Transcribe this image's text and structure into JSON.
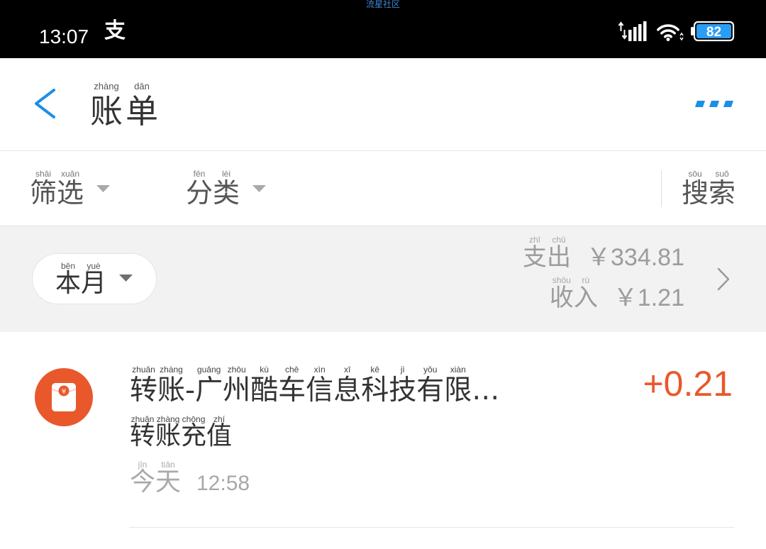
{
  "status_bar": {
    "watermark": "流星社区",
    "time": "13:07",
    "app_glyph": "支",
    "battery_level": "82"
  },
  "header": {
    "title": [
      {
        "char": "账",
        "py": "zhàng"
      },
      {
        "char": "单",
        "py": "dān"
      }
    ]
  },
  "filters": {
    "filter": [
      {
        "char": "筛",
        "py": "shāi"
      },
      {
        "char": "选",
        "py": "xuǎn"
      }
    ],
    "category": [
      {
        "char": "分",
        "py": "fēn"
      },
      {
        "char": "类",
        "py": "lèi"
      }
    ],
    "search": [
      {
        "char": "搜",
        "py": "sōu"
      },
      {
        "char": "索",
        "py": "suǒ"
      }
    ]
  },
  "summary": {
    "period": [
      {
        "char": "本",
        "py": "běn"
      },
      {
        "char": "月",
        "py": "yuè"
      }
    ],
    "expense_label": [
      {
        "char": "支",
        "py": "zhī"
      },
      {
        "char": "出",
        "py": "chū"
      }
    ],
    "expense_amount": "￥334.81",
    "income_label": [
      {
        "char": "收",
        "py": "shōu"
      },
      {
        "char": "入",
        "py": "rù"
      }
    ],
    "income_amount": "￥1.21"
  },
  "transactions": [
    {
      "icon_glyph": "¥",
      "title": [
        {
          "char": "转",
          "py": "zhuǎn"
        },
        {
          "char": "账",
          "py": "zhàng"
        },
        {
          "char": "-",
          "py": ""
        },
        {
          "char": "广",
          "py": "guǎng"
        },
        {
          "char": "州",
          "py": "zhōu"
        },
        {
          "char": "酷",
          "py": "kù"
        },
        {
          "char": "车",
          "py": "chē"
        },
        {
          "char": "信",
          "py": "xìn"
        },
        {
          "char": "息",
          "py": "xī"
        },
        {
          "char": "科",
          "py": "kē"
        },
        {
          "char": "技",
          "py": "jì"
        },
        {
          "char": "有",
          "py": "yǒu"
        },
        {
          "char": "限",
          "py": "xiàn"
        },
        {
          "char": "…",
          "py": ""
        }
      ],
      "amount": "+0.21",
      "subtitle": [
        {
          "char": "转",
          "py": "zhuǎn"
        },
        {
          "char": "账",
          "py": "zhàng"
        },
        {
          "char": "充",
          "py": "chōng"
        },
        {
          "char": "值",
          "py": "zhí"
        }
      ],
      "date_label": [
        {
          "char": "今",
          "py": "jīn"
        },
        {
          "char": "天",
          "py": "tiān"
        }
      ],
      "time": "12:58"
    }
  ],
  "icons": {
    "status": [
      "alipay-icon",
      "signal-icon",
      "wifi-icon",
      "battery-icon"
    ],
    "back": "back-arrow-icon",
    "more": "more-icon",
    "dropdown": "caret-down-icon",
    "totals_chevron": "chevron-right-icon",
    "transaction": "red-envelope-icon"
  },
  "colors": {
    "accent": "#1a8fe8",
    "income_amount": "#e9582b",
    "transaction_icon": "#e9582b",
    "summary_background": "#f2f2f2",
    "battery_fill": "#2a9df4"
  }
}
